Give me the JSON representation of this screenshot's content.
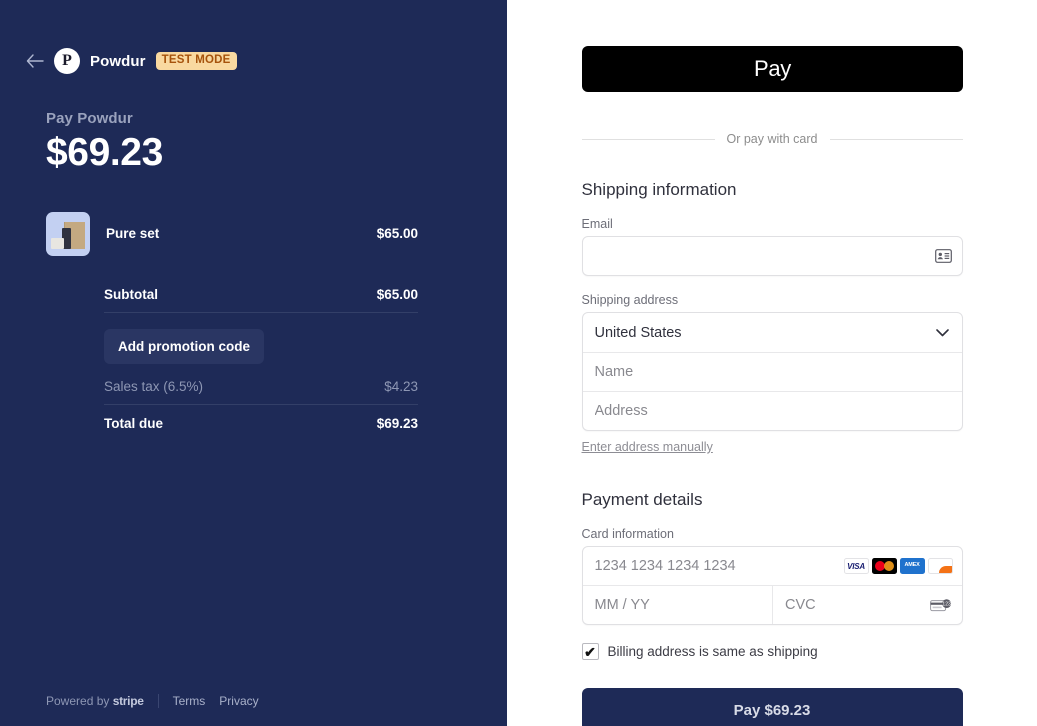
{
  "summary": {
    "back_icon": "arrow-left-icon",
    "logo_letter": "P",
    "merchant": "Powdur",
    "test_badge": "TEST MODE",
    "pay_label": "Pay Powdur",
    "pay_amount": "$69.23",
    "items": [
      {
        "name": "Pure set",
        "price": "$65.00"
      }
    ],
    "subtotal_label": "Subtotal",
    "subtotal_value": "$65.00",
    "promo_label": "Add promotion code",
    "tax_label": "Sales tax (6.5%)",
    "tax_value": "$4.23",
    "total_label": "Total due",
    "total_value": "$69.23",
    "footer": {
      "powered_by": "Powered by",
      "stripe": "stripe",
      "terms": "Terms",
      "privacy": "Privacy"
    }
  },
  "form": {
    "apple_pay_glyph": "",
    "apple_pay_word": "Pay",
    "or_pay_with_card": "Or pay with card",
    "shipping_title": "Shipping information",
    "email_label": "Email",
    "email_value": "",
    "email_placeholder": "",
    "email_icon": "contact-card-icon",
    "shipping_address_label": "Shipping address",
    "country_value": "United States",
    "country_chevron": "chevron-down-icon",
    "name_placeholder": "Name",
    "name_value": "",
    "address_placeholder": "Address",
    "address_value": "",
    "manual_link": "Enter address manually",
    "payment_title": "Payment details",
    "card_info_label": "Card information",
    "card_number_placeholder": "1234 1234 1234 1234",
    "card_number_value": "",
    "expiry_placeholder": "MM / YY",
    "expiry_value": "",
    "cvc_placeholder": "CVC",
    "cvc_value": "",
    "cvc_icon": "cvc-card-icon",
    "card_brands": [
      {
        "name": "visa-icon",
        "label": "VISA"
      },
      {
        "name": "mastercard-icon",
        "label": ""
      },
      {
        "name": "amex-icon",
        "label": "AMEX"
      },
      {
        "name": "discover-icon",
        "label": "DISC"
      }
    ],
    "billing_checkbox_label": "Billing address is same as shipping",
    "billing_checked": true,
    "submit_label": "Pay $69.23"
  },
  "colors": {
    "navy": "#1e2a57",
    "promo_bg": "#2a3663",
    "badge_bg": "#f9d9a0",
    "badge_text": "#a6530c",
    "thumb_bg": "#c3d0f2"
  }
}
